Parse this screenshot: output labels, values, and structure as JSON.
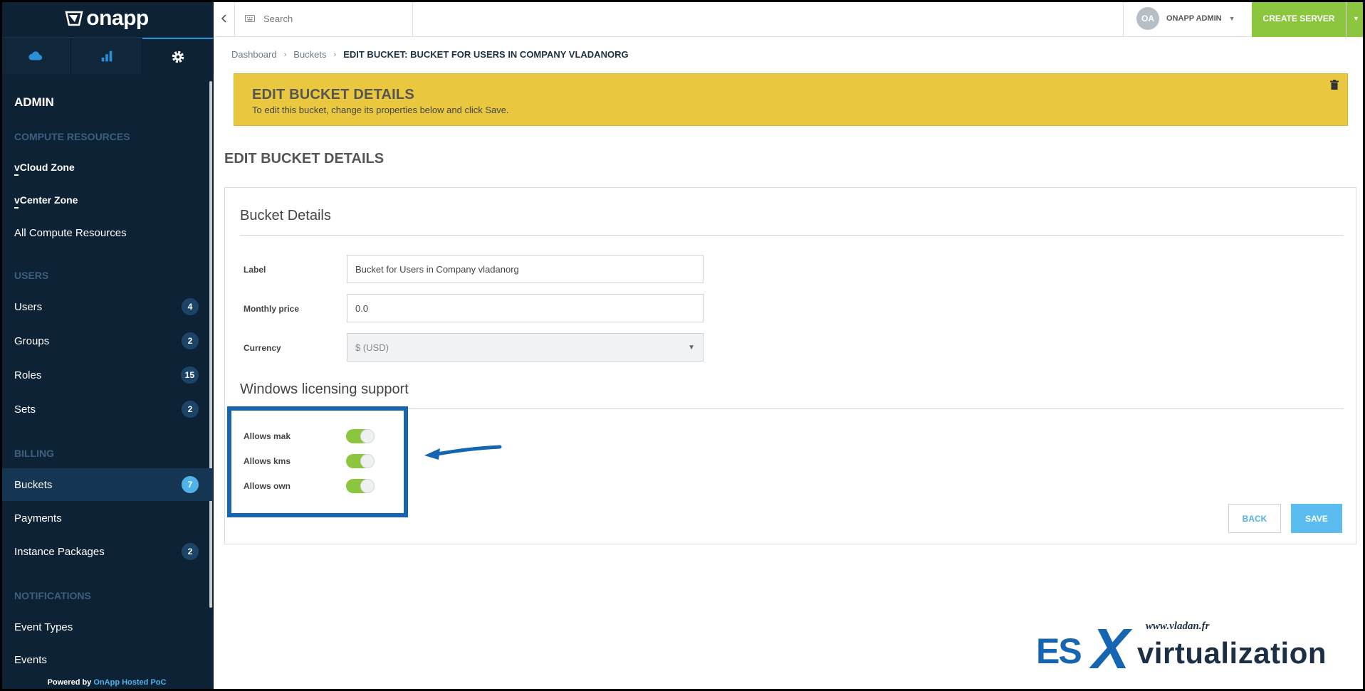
{
  "brand": {
    "name": "onapp"
  },
  "sidebar": {
    "heading": "ADMIN",
    "sections": [
      {
        "title": "COMPUTE RESOURCES"
      },
      {
        "title": "USERS"
      },
      {
        "title": "BILLING"
      },
      {
        "title": "NOTIFICATIONS"
      }
    ],
    "items": [
      {
        "label": "vCloud Zone"
      },
      {
        "label": "vCenter Zone"
      },
      {
        "label": "All Compute Resources"
      },
      {
        "label": "Users",
        "badge": "4"
      },
      {
        "label": "Groups",
        "badge": "2"
      },
      {
        "label": "Roles",
        "badge": "15"
      },
      {
        "label": "Sets",
        "badge": "2"
      },
      {
        "label": "Buckets",
        "badge": "7",
        "active": true
      },
      {
        "label": "Payments"
      },
      {
        "label": "Instance Packages",
        "badge": "2"
      },
      {
        "label": "Event Types"
      },
      {
        "label": "Events"
      }
    ],
    "footer": {
      "prefix": "Powered by",
      "link": "OnApp Hosted PoC"
    }
  },
  "topbar": {
    "search_placeholder": "Search",
    "user_initials": "OA",
    "user_name": "ONAPP ADMIN",
    "create_label": "CREATE SERVER"
  },
  "breadcrumb": {
    "items": [
      "Dashboard",
      "Buckets"
    ],
    "current": "EDIT BUCKET: BUCKET FOR USERS IN COMPANY VLADANORG"
  },
  "banner": {
    "title": "EDIT BUCKET DETAILS",
    "subtitle": "To edit this bucket, change its properties below and click Save."
  },
  "page_title": "EDIT BUCKET DETAILS",
  "form": {
    "details_title": "Bucket Details",
    "fields": {
      "label": {
        "label": "Label",
        "value": "Bucket for Users in Company vladanorg"
      },
      "monthly_price": {
        "label": "Monthly price",
        "value": "0.0"
      },
      "currency": {
        "label": "Currency",
        "value": "$ (USD)"
      }
    },
    "licensing_title": "Windows licensing support",
    "toggles": [
      {
        "label": "Allows mak",
        "on": true
      },
      {
        "label": "Allows kms",
        "on": true
      },
      {
        "label": "Allows own",
        "on": true
      }
    ],
    "back_label": "BACK",
    "save_label": "SAVE"
  },
  "watermark": {
    "url": "www.vladan.fr",
    "brand_prefix": "ES",
    "brand_x": "X",
    "brand_suffix": "virtualization"
  },
  "colors": {
    "sidebar_bg": "#0d2235",
    "accent_green": "#8cc63f",
    "accent_blue": "#5bbcf0",
    "banner_yellow": "#e9c840",
    "highlight_blue": "#1565b3"
  }
}
